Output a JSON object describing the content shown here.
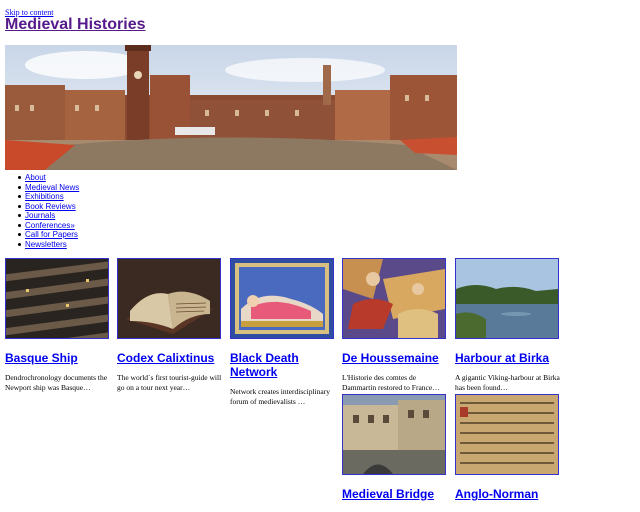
{
  "header": {
    "skip_link": "Skip to content",
    "site_title": "Medieval Histories"
  },
  "nav": {
    "items": [
      "About",
      "Medieval News",
      "Exhibitions",
      "Book Reviews",
      "Journals",
      "Conferences»",
      "Call for Papers",
      "Newsletters"
    ]
  },
  "cards": [
    {
      "title": "Basque Ship",
      "excerpt": "Dendrochronology documents the Newport ship was Basque…",
      "image_icon": "wooden-ship-timbers-photo"
    },
    {
      "title": "Codex Calixtinus",
      "excerpt": "The world´s first tourist-guide will go on a tour next year…",
      "image_icon": "open-manuscript-book-photo"
    },
    {
      "title": "Black Death Network",
      "excerpt": "Network creates interdisciplinary forum of medievalists …",
      "image_icon": "illuminated-sick-man-illustration"
    },
    {
      "title": "De Houssemaine",
      "excerpt": "L'Historie des comtes de Dammartin restored to France…",
      "image_icon": "illuminated-manuscript-scene"
    },
    {
      "title": "Harbour at Birka",
      "excerpt": "A gigantic Viking-harbour at Birka has been found…",
      "image_icon": "lake-harbour-photo"
    },
    {
      "title": "Medieval Bridge",
      "excerpt": "",
      "image_icon": "town-bridge-photo"
    },
    {
      "title": "Anglo-Norman",
      "excerpt": "",
      "image_icon": "manuscript-text-closeup"
    }
  ]
}
